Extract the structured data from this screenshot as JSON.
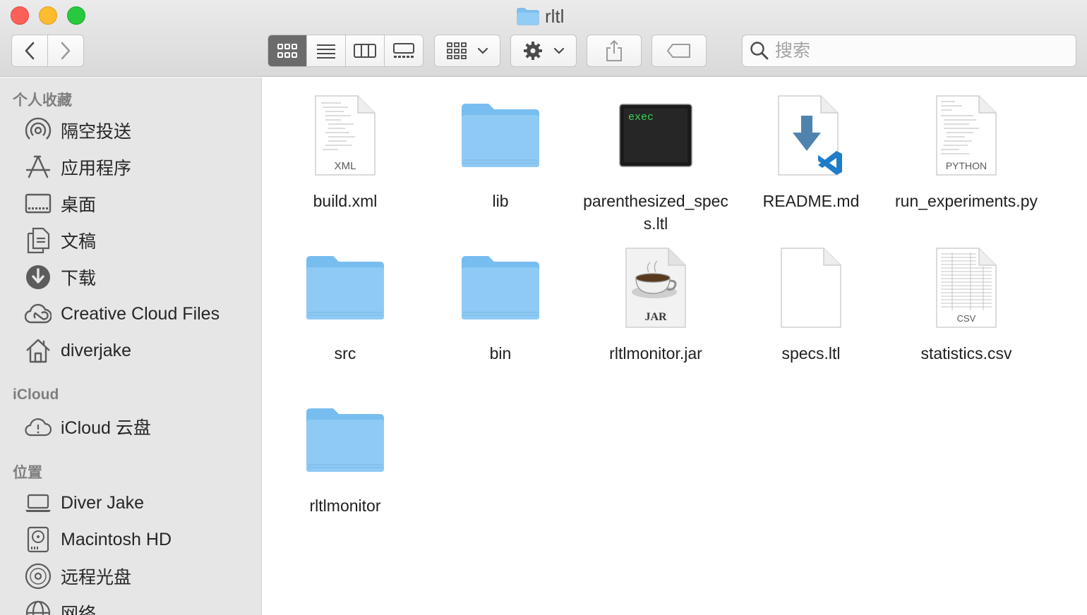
{
  "window": {
    "title": "rltl"
  },
  "toolbar": {
    "back": "back",
    "forward": "forward",
    "views": [
      "icon-view",
      "list-view",
      "column-view",
      "gallery-view"
    ],
    "search_placeholder": "搜索"
  },
  "sidebar": {
    "favorites_title": "个人收藏",
    "favorites": [
      {
        "label": "隔空投送",
        "icon": "airdrop-icon"
      },
      {
        "label": "应用程序",
        "icon": "applications-icon"
      },
      {
        "label": "桌面",
        "icon": "desktop-icon"
      },
      {
        "label": "文稿",
        "icon": "documents-icon"
      },
      {
        "label": "下载",
        "icon": "downloads-icon"
      },
      {
        "label": "Creative Cloud Files",
        "icon": "creative-cloud-icon"
      },
      {
        "label": "diverjake",
        "icon": "home-icon"
      }
    ],
    "icloud_title": "iCloud",
    "icloud": [
      {
        "label": "iCloud 云盘",
        "icon": "icloud-icon"
      }
    ],
    "locations_title": "位置",
    "locations": [
      {
        "label": "Diver Jake",
        "icon": "laptop-icon"
      },
      {
        "label": "Macintosh HD",
        "icon": "hard-drive-icon"
      },
      {
        "label": "远程光盘",
        "icon": "remote-disc-icon"
      },
      {
        "label": "网络",
        "icon": "network-icon"
      }
    ]
  },
  "files": [
    {
      "name": "build.xml",
      "kind": "xml-file",
      "badge": "XML"
    },
    {
      "name": "lib",
      "kind": "folder"
    },
    {
      "name": "parenthesized_specs.ltl",
      "kind": "exec-file",
      "badge": "exec"
    },
    {
      "name": "README.md",
      "kind": "vscode-file"
    },
    {
      "name": "run_experiments.py",
      "kind": "python-file",
      "badge": "PYTHON"
    },
    {
      "name": "src",
      "kind": "folder"
    },
    {
      "name": "bin",
      "kind": "folder"
    },
    {
      "name": "rltlmonitor.jar",
      "kind": "jar-file",
      "badge": "JAR"
    },
    {
      "name": "specs.ltl",
      "kind": "blank-file"
    },
    {
      "name": "statistics.csv",
      "kind": "csv-file",
      "badge": "CSV"
    },
    {
      "name": "rltlmonitor",
      "kind": "folder"
    }
  ]
}
